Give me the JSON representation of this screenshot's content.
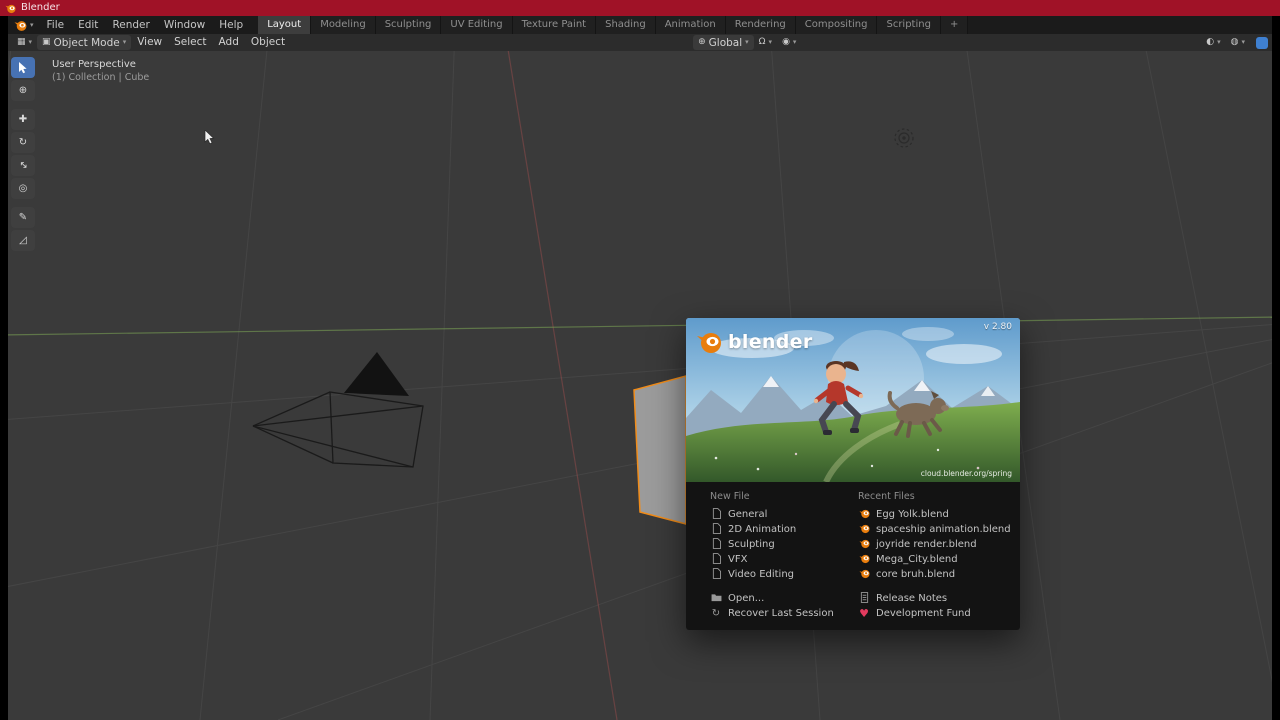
{
  "titlebar": {
    "title": "Blender"
  },
  "menubar": {
    "menus": [
      "File",
      "Edit",
      "Render",
      "Window",
      "Help"
    ],
    "workspaces": [
      {
        "label": "Layout",
        "active": true
      },
      {
        "label": "Modeling"
      },
      {
        "label": "Sculpting"
      },
      {
        "label": "UV Editing"
      },
      {
        "label": "Texture Paint"
      },
      {
        "label": "Shading"
      },
      {
        "label": "Animation"
      },
      {
        "label": "Rendering"
      },
      {
        "label": "Compositing"
      },
      {
        "label": "Scripting"
      }
    ],
    "add_workspace": "+"
  },
  "header": {
    "mode": "Object Mode",
    "menus": [
      "View",
      "Select",
      "Add",
      "Object"
    ],
    "orientation": "Global"
  },
  "viewport": {
    "perspective": "User Perspective",
    "breadcrumb": "(1) Collection | Cube"
  },
  "splash": {
    "version": "v 2.80",
    "brand": "blender",
    "credit": "cloud.blender.org/spring",
    "new_file": {
      "title": "New File",
      "items": [
        "General",
        "2D Animation",
        "Sculpting",
        "VFX",
        "Video Editing"
      ]
    },
    "recent": {
      "title": "Recent Files",
      "items": [
        "Egg Yolk.blend",
        "spaceship animation.blend",
        "joyride render.blend",
        "Mega_City.blend",
        "core bruh.blend"
      ]
    },
    "footer_left": [
      "Open...",
      "Recover Last Session"
    ],
    "footer_right": [
      "Release Notes",
      "Development Fund"
    ]
  },
  "icons": {
    "editor_type": "▦",
    "mode": "▣",
    "caret": "▾",
    "orientation": "⊕",
    "snap_magnet": "Ω",
    "proportional": "◉",
    "overlay_a": "◐",
    "overlay_b": "◍",
    "tool_cursor": "⊕",
    "tool_move": "✚",
    "tool_rotate": "↻",
    "tool_scale": "↔",
    "tool_transform": "◎",
    "tool_annotate": "✎",
    "tool_measure": "◿",
    "recover": "↻",
    "heart": "♥"
  },
  "colors": {
    "accent": "#e87d0d",
    "tool_active": "#4772b3",
    "titlebar": "#a01227",
    "heart": "#e43b5f",
    "axis_x": "#b05050",
    "axis_y": "#7da856"
  }
}
